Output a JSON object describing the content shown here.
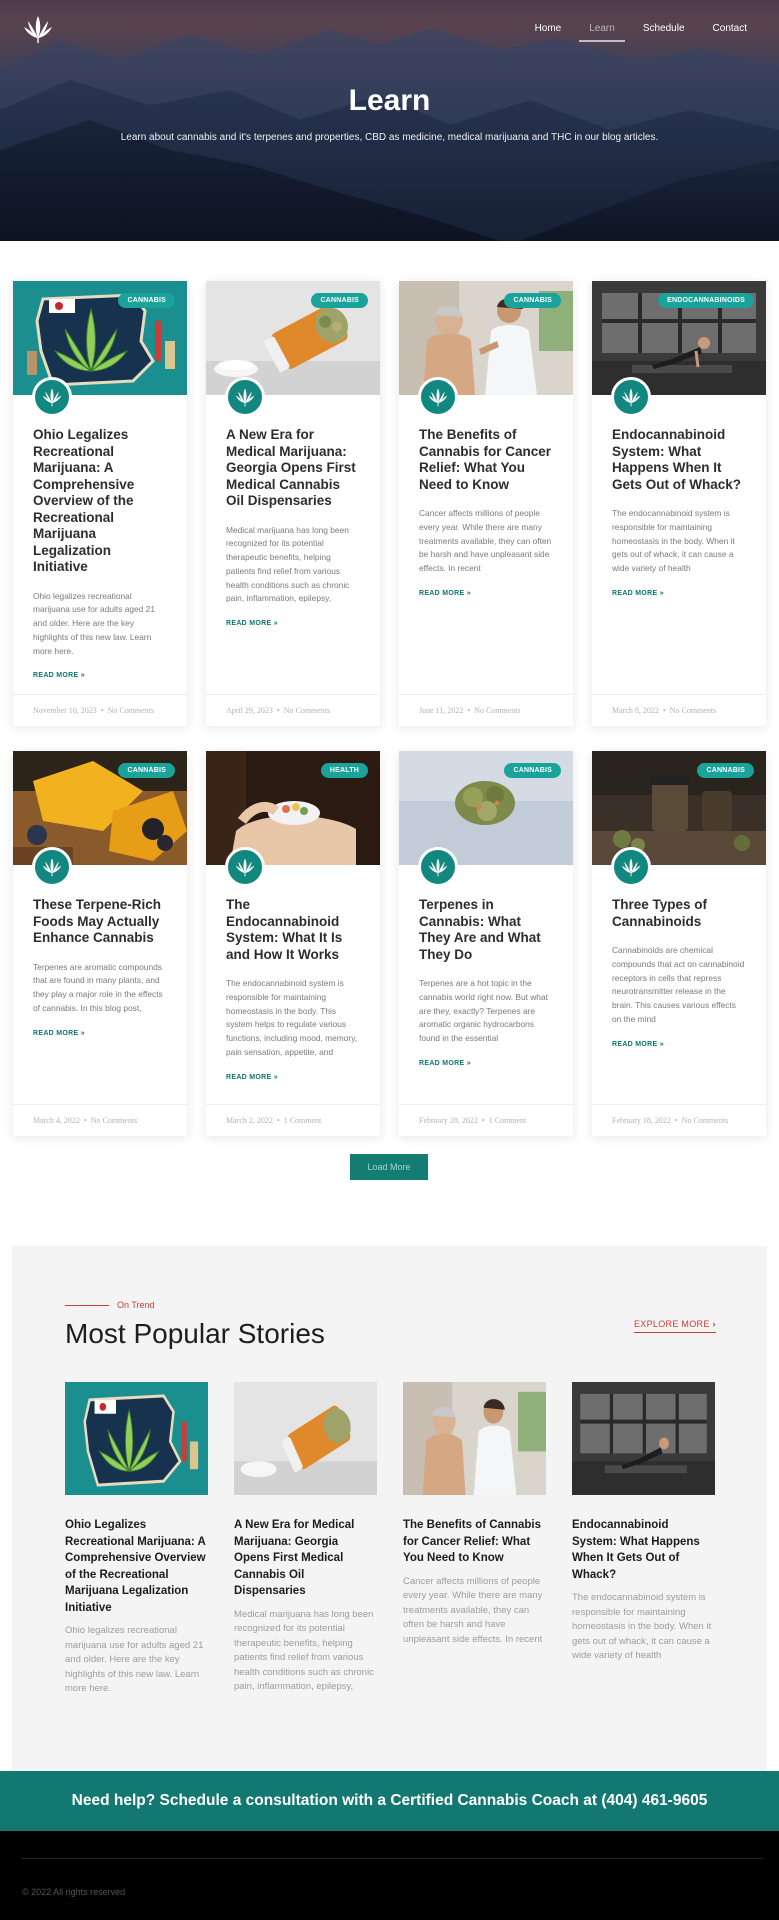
{
  "nav": {
    "items": [
      {
        "label": "Home",
        "active": false
      },
      {
        "label": "Learn",
        "active": true
      },
      {
        "label": "Schedule",
        "active": false
      },
      {
        "label": "Contact",
        "active": false
      }
    ]
  },
  "hero": {
    "title": "Learn",
    "subtitle": "Learn about cannabis and it's terpenes and properties, CBD as medicine, medical marijuana and THC in our blog articles."
  },
  "posts": [
    {
      "badge": "CANNABIS",
      "title": "Ohio Legalizes Recreational Marijuana: A Comprehensive Overview of the Recreational Marijuana Legalization Initiative",
      "excerpt": "Ohio legalizes recreational marijuana use for adults aged 21 and older. Here are the key highlights of this new law. Learn more here.",
      "more": "READ MORE »",
      "date": "November 10, 2023",
      "comments": "No Comments",
      "image": "ohio-map-leaf"
    },
    {
      "badge": "CANNABIS",
      "title": "A New Era for Medical Marijuana: Georgia Opens First Medical Cannabis Oil Dispensaries",
      "excerpt": "Medical marijuana has long been recognized for its potential therapeutic benefits, helping patients find relief from various health conditions such as chronic pain, inflammation, epilepsy,",
      "more": "READ MORE »",
      "date": "April 29, 2023",
      "comments": "No Comments",
      "image": "pill-bottle-bud"
    },
    {
      "badge": "CANNABIS",
      "title": "The Benefits of Cannabis for Cancer Relief: What You Need to Know",
      "excerpt": "Cancer affects millions of people every year. While there are many treatments available, they can often be harsh and have unpleasant side effects. In recent",
      "more": "READ MORE »",
      "date": "June 11, 2022",
      "comments": "No Comments",
      "image": "nurse-patient"
    },
    {
      "badge": "ENDOCANNABINOIDS",
      "title": "Endocannabinoid System: What Happens When It Gets Out of Whack?",
      "excerpt": "The endocannabinoid system is responsible for maintaining homeostasis in the body. When it gets out of whack, it can cause a wide variety of health",
      "more": "READ MORE »",
      "date": "March 8, 2022",
      "comments": "No Comments",
      "image": "gym-workout"
    },
    {
      "badge": "CANNABIS",
      "title": "These Terpene-Rich Foods May Actually Enhance Cannabis",
      "excerpt": "Terpenes are aromatic compounds that are found in many plants, and they play a major role in the effects of cannabis. In this blog post,",
      "more": "READ MORE »",
      "date": "March 4, 2022",
      "comments": "No Comments",
      "image": "mango-berries"
    },
    {
      "badge": "HEALTH",
      "title": "The Endocannabinoid System: What It Is and How It Works",
      "excerpt": "The endocannabinoid system is responsible for maintaining homeostasis in the body. This system helps to regulate various functions, including mood, memory, pain sensation, appetite, and",
      "more": "READ MORE »",
      "date": "March 2, 2022",
      "comments": "1 Comment",
      "image": "hands-bowl"
    },
    {
      "badge": "CANNABIS",
      "title": "Terpenes in Cannabis: What They Are and What They Do",
      "excerpt": "Terpenes are a hot topic in the cannabis world right now. But what are they, exactly? Terpenes are aromatic organic hydrocarbons found in the essential",
      "more": "READ MORE »",
      "date": "February 28, 2022",
      "comments": "1 Comment",
      "image": "cannabis-bud"
    },
    {
      "badge": "CANNABIS",
      "title": "Three Types of Cannabinoids",
      "excerpt": "Cannabinoids are chemical compounds that act on cannabinoid receptors in cells that repress neurotransmitter release in the brain. This causes various effects on the mind",
      "more": "READ MORE »",
      "date": "February 18, 2022",
      "comments": "No Comments",
      "image": "jars-buds"
    }
  ],
  "load_more": "Load More",
  "popular": {
    "eyebrow": "On Trend",
    "title": "Most Popular Stories",
    "explore": "EXPLORE MORE",
    "items": [
      {
        "title": "Ohio Legalizes Recreational Marijuana: A Comprehensive Overview of the Recreational Marijuana Legalization Initiative",
        "excerpt": "Ohio legalizes recreational marijuana use for adults aged 21 and older. Here are the key highlights of this new law. Learn more here.",
        "image": "ohio-map-leaf"
      },
      {
        "title": "A New Era for Medical Marijuana: Georgia Opens First Medical Cannabis Oil Dispensaries",
        "excerpt": "Medical marijuana has long been recognized for its potential therapeutic benefits, helping patients find relief from various health conditions such as chronic pain, inflammation, epilepsy,",
        "image": "pill-bottle-bud"
      },
      {
        "title": "The Benefits of Cannabis for Cancer Relief: What You Need to Know",
        "excerpt": "Cancer affects millions of people every year. While there are many treatments available, they can often be harsh and have unpleasant side effects. In recent",
        "image": "nurse-patient"
      },
      {
        "title": "Endocannabinoid System: What Happens When It Gets Out of Whack?",
        "excerpt": "The endocannabinoid system is responsible for maintaining homeostasis in the body. When it gets out of whack, it can cause a wide variety of health",
        "image": "gym-workout"
      }
    ]
  },
  "cta": "Need help? Schedule a consultation with a Certified Cannabis Coach at (404) 461-9605",
  "footer": {
    "copyright": "© 2022 All rights reserved"
  },
  "colors": {
    "accent": "#1aa39a",
    "brand_dark": "#137871",
    "trend_red": "#c6403a"
  }
}
